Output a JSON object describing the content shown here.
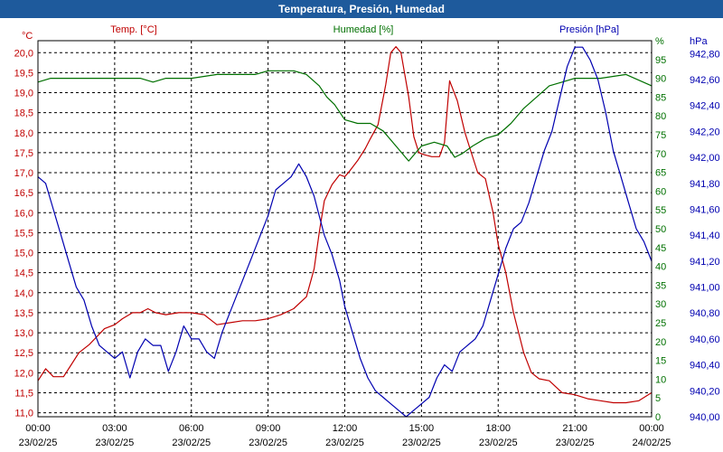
{
  "window": {
    "title": "Temperatura, Presión, Humedad"
  },
  "colors": {
    "title_bg": "#1e5a9c",
    "temp": "#c00000",
    "humidity": "#007000",
    "pressure": "#0000b0",
    "grid": "#000000"
  },
  "chart_data": {
    "type": "line",
    "title": "Temperatura, Presión, Humedad",
    "grid": true,
    "x_range": [
      "23/02/25 00:00",
      "24/02/25 00:00"
    ],
    "x_ticks": [
      {
        "hour": 0,
        "time": "00:00",
        "date": "23/02/25"
      },
      {
        "hour": 3,
        "time": "03:00",
        "date": "23/02/25"
      },
      {
        "hour": 6,
        "time": "06:00",
        "date": "23/02/25"
      },
      {
        "hour": 9,
        "time": "09:00",
        "date": "23/02/25"
      },
      {
        "hour": 12,
        "time": "12:00",
        "date": "23/02/25"
      },
      {
        "hour": 15,
        "time": "15:00",
        "date": "23/02/25"
      },
      {
        "hour": 18,
        "time": "18:00",
        "date": "23/02/25"
      },
      {
        "hour": 21,
        "time": "21:00",
        "date": "23/02/25"
      },
      {
        "hour": 24,
        "time": "00:00",
        "date": "24/02/25"
      }
    ],
    "axes": {
      "temp": {
        "label": "Temp. [°C]",
        "unit": "°C",
        "ylim": [
          10.9,
          20.3
        ],
        "ticks": [
          "11,0",
          "11,5",
          "12,0",
          "12,5",
          "13,0",
          "13,5",
          "14,0",
          "14,5",
          "15,0",
          "15,5",
          "16,0",
          "16,5",
          "17,0",
          "17,5",
          "18,0",
          "18,5",
          "19,0",
          "19,5",
          "20,0"
        ],
        "tick_values": [
          11,
          11.5,
          12,
          12.5,
          13,
          13.5,
          14,
          14.5,
          15,
          15.5,
          16,
          16.5,
          17,
          17.5,
          18,
          18.5,
          19,
          19.5,
          20
        ]
      },
      "humidity": {
        "label": "Humedad [%]",
        "unit": "%",
        "ylim": [
          0,
          100
        ],
        "ticks": [
          "0",
          "5",
          "10",
          "15",
          "20",
          "25",
          "30",
          "35",
          "40",
          "45",
          "50",
          "55",
          "60",
          "65",
          "70",
          "75",
          "80",
          "85",
          "90",
          "95"
        ],
        "tick_values": [
          0,
          5,
          10,
          15,
          20,
          25,
          30,
          35,
          40,
          45,
          50,
          55,
          60,
          65,
          70,
          75,
          80,
          85,
          90,
          95
        ]
      },
      "pressure": {
        "label": "Presión [hPa]",
        "unit": "hPa",
        "ylim": [
          940.0,
          942.9
        ],
        "ticks": [
          "940,00",
          "940,20",
          "940,40",
          "940,60",
          "940,80",
          "941,00",
          "941,20",
          "941,40",
          "941,60",
          "941,80",
          "942,00",
          "942,20",
          "942,40",
          "942,60",
          "942,80"
        ],
        "tick_values": [
          940,
          940.2,
          940.4,
          940.6,
          940.8,
          941,
          941.2,
          941.4,
          941.6,
          941.8,
          942,
          942.2,
          942.4,
          942.6,
          942.8
        ]
      }
    },
    "series": [
      {
        "name": "Temp. [°C]",
        "axis": "temp",
        "color": "#c00000",
        "x": [
          0,
          0.3,
          0.6,
          1,
          1.3,
          1.6,
          2,
          2.3,
          2.6,
          3,
          3.3,
          3.7,
          4,
          4.3,
          4.6,
          5,
          5.5,
          6,
          6.5,
          7,
          7.5,
          8,
          8.5,
          9,
          9.5,
          10,
          10.5,
          10.8,
          11,
          11.2,
          11.5,
          11.8,
          12,
          12.2,
          12.5,
          12.8,
          13,
          13.3,
          13.6,
          13.8,
          14,
          14.2,
          14.5,
          14.7,
          14.9,
          15.1,
          15.4,
          15.7,
          15.9,
          16.1,
          16.4,
          16.7,
          16.9,
          17.2,
          17.5,
          17.8,
          18,
          18.3,
          18.6,
          19,
          19.3,
          19.6,
          20,
          20.5,
          21,
          21.5,
          22,
          22.5,
          23,
          23.5,
          24
        ],
        "values": [
          11.8,
          12.1,
          11.9,
          11.9,
          12.2,
          12.5,
          12.7,
          12.9,
          13.1,
          13.2,
          13.35,
          13.5,
          13.5,
          13.6,
          13.5,
          13.45,
          13.5,
          13.5,
          13.45,
          13.2,
          13.25,
          13.3,
          13.3,
          13.35,
          13.45,
          13.6,
          13.9,
          14.6,
          15.5,
          16.3,
          16.7,
          16.95,
          16.9,
          17.05,
          17.3,
          17.6,
          17.85,
          18.2,
          19.2,
          20.0,
          20.15,
          20.0,
          18.9,
          17.9,
          17.5,
          17.45,
          17.4,
          17.4,
          17.75,
          19.3,
          18.8,
          18.0,
          17.6,
          17.0,
          16.85,
          16.0,
          15.2,
          14.5,
          13.5,
          12.5,
          12.0,
          11.85,
          11.8,
          11.5,
          11.45,
          11.35,
          11.3,
          11.25,
          11.25,
          11.3,
          11.5
        ]
      },
      {
        "name": "Humedad [%]",
        "axis": "humidity",
        "color": "#007000",
        "x": [
          0,
          0.5,
          1,
          2,
          3,
          4,
          4.5,
          5,
          6,
          7,
          8,
          8.5,
          9,
          9.5,
          10,
          10.5,
          11,
          11.3,
          11.6,
          12,
          12.5,
          13,
          13.5,
          14,
          14.5,
          15,
          15.5,
          16,
          16.3,
          16.6,
          17,
          17.5,
          18,
          18.5,
          19,
          19.5,
          20,
          20.5,
          21,
          21.5,
          22,
          23,
          24
        ],
        "values": [
          89,
          90,
          90,
          90,
          90,
          90,
          89,
          90,
          90,
          91,
          91,
          91,
          92,
          92,
          92,
          91,
          88,
          85,
          83,
          79,
          78,
          78,
          76,
          72,
          68,
          72,
          73,
          72,
          69,
          70,
          72,
          74,
          75,
          78,
          82,
          85,
          88,
          89,
          90,
          90,
          90,
          91,
          88
        ]
      },
      {
        "name": "Presión [hPa]",
        "axis": "pressure",
        "color": "#0000b0",
        "x": [
          0,
          0.3,
          0.6,
          0.9,
          1.2,
          1.5,
          1.8,
          2.1,
          2.4,
          2.7,
          3,
          3.3,
          3.6,
          3.9,
          4.2,
          4.5,
          4.8,
          5.1,
          5.4,
          5.7,
          6,
          6.3,
          6.6,
          6.9,
          7.2,
          7.5,
          7.8,
          8.1,
          8.4,
          8.7,
          9,
          9.3,
          9.6,
          9.9,
          10.2,
          10.5,
          10.8,
          11,
          11.2,
          11.5,
          11.8,
          12,
          12.3,
          12.6,
          12.9,
          13.2,
          13.5,
          13.8,
          14.1,
          14.4,
          14.7,
          15,
          15.3,
          15.6,
          15.9,
          16.2,
          16.5,
          16.8,
          17.1,
          17.4,
          17.7,
          18,
          18.3,
          18.6,
          18.9,
          19.2,
          19.5,
          19.8,
          20.1,
          20.4,
          20.7,
          21,
          21.3,
          21.6,
          21.9,
          22.2,
          22.5,
          22.8,
          23.1,
          23.4,
          23.7,
          24
        ],
        "values": [
          941.85,
          941.8,
          941.6,
          941.4,
          941.2,
          941.0,
          940.9,
          940.7,
          940.55,
          940.5,
          940.45,
          940.5,
          940.3,
          940.5,
          940.6,
          940.55,
          940.55,
          940.35,
          940.5,
          940.7,
          940.6,
          940.6,
          940.5,
          940.45,
          940.65,
          940.8,
          940.95,
          941.1,
          941.25,
          941.4,
          941.55,
          941.75,
          941.8,
          941.85,
          941.95,
          941.85,
          941.7,
          941.55,
          941.4,
          941.25,
          941.05,
          940.85,
          940.65,
          940.45,
          940.3,
          940.2,
          940.15,
          940.1,
          940.05,
          940.0,
          940.05,
          940.1,
          940.15,
          940.3,
          940.4,
          940.35,
          940.5,
          940.55,
          940.6,
          940.7,
          940.9,
          941.1,
          941.3,
          941.45,
          941.5,
          941.65,
          941.85,
          942.05,
          942.2,
          942.45,
          942.7,
          942.85,
          942.85,
          942.75,
          942.6,
          942.35,
          942.05,
          941.85,
          941.65,
          941.45,
          941.35,
          941.2
        ]
      }
    ]
  }
}
